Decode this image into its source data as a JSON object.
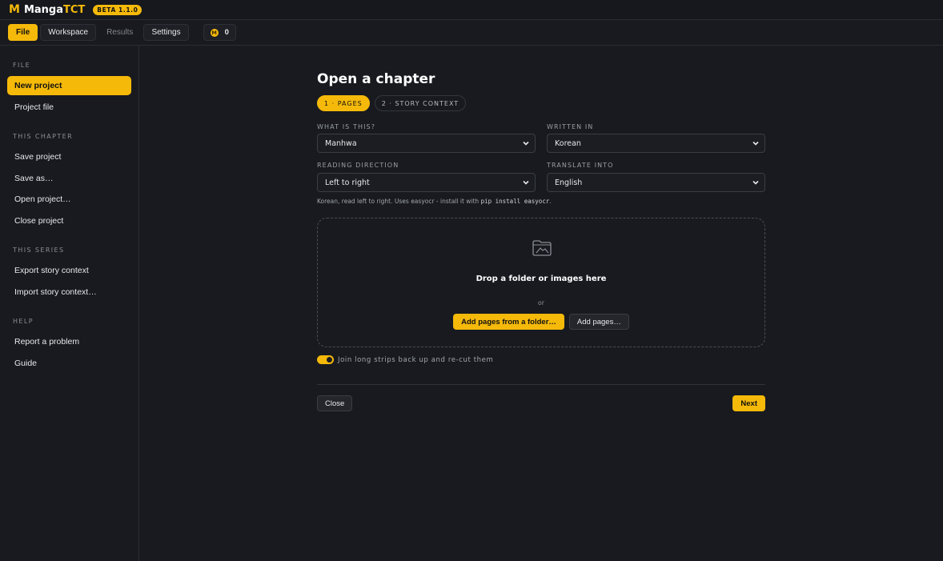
{
  "app": {
    "logo_mark": "M",
    "name_main": "Manga",
    "name_accent": "TCT",
    "version_badge": "BETA 1.1.0"
  },
  "toolbar": {
    "tabs": [
      {
        "label": "File"
      },
      {
        "label": "Workspace"
      },
      {
        "label": "Results"
      },
      {
        "label": "Settings"
      }
    ],
    "credits_icon": "M",
    "credits_value": "0"
  },
  "sidebar": {
    "sections": [
      {
        "title": "FILE",
        "items": [
          {
            "label": "New project"
          },
          {
            "label": "Project file"
          }
        ]
      },
      {
        "title": "THIS CHAPTER",
        "items": [
          {
            "label": "Save project"
          },
          {
            "label": "Save as…"
          },
          {
            "label": "Open project…"
          },
          {
            "label": "Close project"
          }
        ]
      },
      {
        "title": "THIS SERIES",
        "items": [
          {
            "label": "Export story context"
          },
          {
            "label": "Import story context…"
          }
        ]
      },
      {
        "title": "HELP",
        "items": [
          {
            "label": "Report a problem"
          },
          {
            "label": "Guide"
          }
        ]
      }
    ]
  },
  "main": {
    "title": "Open a chapter",
    "steps": [
      {
        "label": "1 · PAGES"
      },
      {
        "label": "2 · STORY CONTEXT"
      }
    ],
    "fields": {
      "what_label": "WHAT IS THIS?",
      "what_value": "Manhwa",
      "written_label": "WRITTEN IN",
      "written_value": "Korean",
      "direction_label": "READING DIRECTION",
      "direction_value": "Left to right",
      "translate_label": "TRANSLATE INTO",
      "translate_value": "English"
    },
    "hint_text": "Korean, read left to right. Uses easyocr - install it with ",
    "hint_code": "pip install easyocr",
    "hint_end": ".",
    "dropzone": {
      "icon": "folder-image-icon",
      "text": "Drop a folder or images here",
      "or": "or",
      "btn_folder": "Add pages from a folder…",
      "btn_pages": "Add pages…"
    },
    "toggle_label": "Join long strips back up and re-cut them",
    "toggle_on": true,
    "close_label": "Close",
    "next_label": "Next"
  },
  "colors": {
    "accent": "#f5b90a",
    "background": "#181a1f"
  }
}
